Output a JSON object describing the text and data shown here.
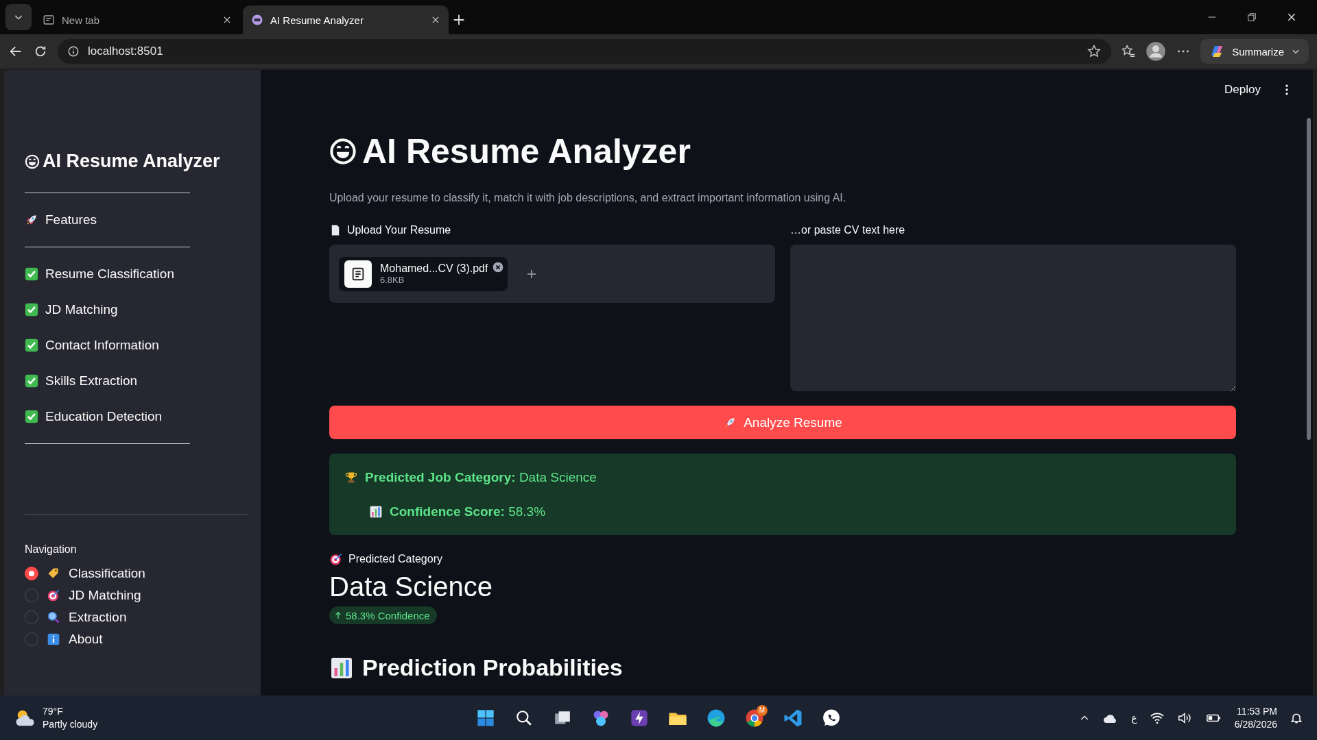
{
  "browser": {
    "tabs": [
      {
        "title": "New tab",
        "selected": false
      },
      {
        "title": "AI Resume Analyzer",
        "selected": true
      }
    ],
    "address": "localhost:8501",
    "summarize": "Summarize"
  },
  "sidebar": {
    "title": "AI Resume Analyzer",
    "features_heading": "Features",
    "features": [
      {
        "label": "Resume Classification",
        "checked": true
      },
      {
        "label": "JD Matching",
        "checked": true
      },
      {
        "label": "Contact Information",
        "checked": true
      },
      {
        "label": "Skills Extraction",
        "checked": true
      },
      {
        "label": "Education Detection",
        "checked": true
      }
    ],
    "navigation": {
      "label": "Navigation",
      "options": [
        {
          "label": "Classification",
          "selected": true
        },
        {
          "label": "JD Matching",
          "selected": false
        },
        {
          "label": "Extraction",
          "selected": false
        },
        {
          "label": "About",
          "selected": false
        }
      ]
    }
  },
  "main": {
    "deploy": "Deploy",
    "title": "AI Resume Analyzer",
    "subtitle": "Upload your resume to classify it, match it with job descriptions, and extract important information using AI.",
    "upload": {
      "label": "Upload Your Resume",
      "file_name": "Mohamed...CV (3).pdf",
      "file_size": "6.8KB"
    },
    "paste": {
      "label": "…or paste CV text here"
    },
    "analyze_button": "Analyze Resume",
    "result": {
      "category_label": "Predicted Job Category:",
      "category_value": "Data Science",
      "confidence_label": "Confidence Score:",
      "confidence_value": "58.3%"
    },
    "metric": {
      "label": "Predicted Category",
      "value": "Data Science",
      "delta": "58.3% Confidence"
    },
    "section_heading": "Prediction Probabilities"
  },
  "taskbar": {
    "temperature": "79°F",
    "weather": "Partly cloudy",
    "profile_badge": "M",
    "language": "ع",
    "time": "11:53 PM",
    "date": "6/28/2026"
  }
}
